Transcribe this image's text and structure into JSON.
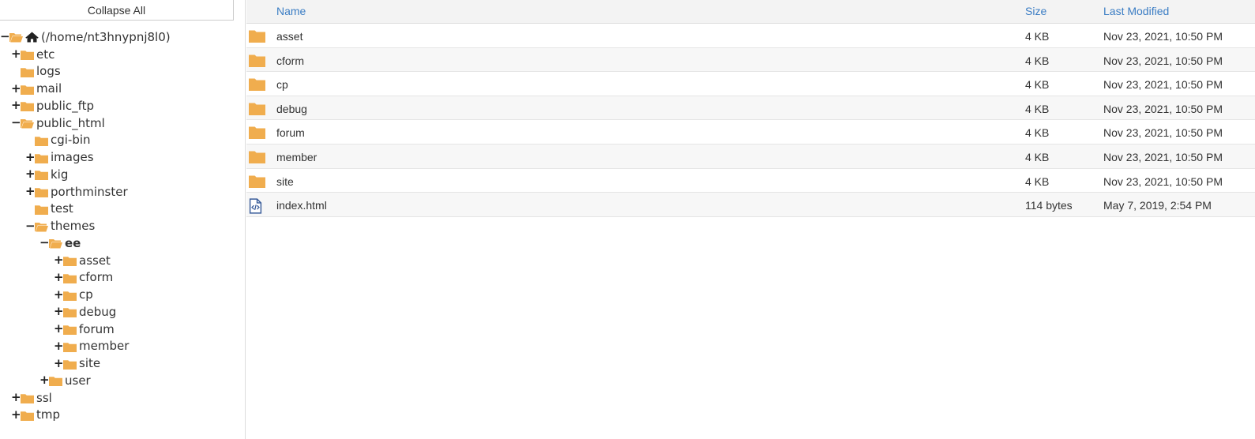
{
  "tree_panel": {
    "collapse_all_label": "Collapse All",
    "nodes": [
      {
        "label": "(/home/nt3hnypnj8l0)",
        "toggle": "−",
        "icon": "home-icon",
        "depth": 0
      },
      {
        "label": "etc",
        "toggle": "+",
        "icon": "folder-icon",
        "depth": 1
      },
      {
        "label": "logs",
        "toggle": "",
        "icon": "folder-icon",
        "depth": 1
      },
      {
        "label": "mail",
        "toggle": "+",
        "icon": "folder-icon",
        "depth": 1
      },
      {
        "label": "public_ftp",
        "toggle": "+",
        "icon": "folder-icon",
        "depth": 1
      },
      {
        "label": "public_html",
        "toggle": "−",
        "icon": "folder-open-icon",
        "depth": 1
      },
      {
        "label": "cgi-bin",
        "toggle": "",
        "icon": "folder-icon",
        "depth": 2
      },
      {
        "label": "images",
        "toggle": "+",
        "icon": "folder-icon",
        "depth": 2
      },
      {
        "label": "kig",
        "toggle": "+",
        "icon": "folder-icon",
        "depth": 2
      },
      {
        "label": "porthminster",
        "toggle": "+",
        "icon": "folder-icon",
        "depth": 2
      },
      {
        "label": "test",
        "toggle": "",
        "icon": "folder-icon",
        "depth": 2
      },
      {
        "label": "themes",
        "toggle": "−",
        "icon": "folder-open-icon",
        "depth": 2
      },
      {
        "label": "ee",
        "toggle": "−",
        "icon": "folder-open-icon",
        "depth": 3,
        "selected": true
      },
      {
        "label": "asset",
        "toggle": "+",
        "icon": "folder-icon",
        "depth": 4
      },
      {
        "label": "cform",
        "toggle": "+",
        "icon": "folder-icon",
        "depth": 4
      },
      {
        "label": "cp",
        "toggle": "+",
        "icon": "folder-icon",
        "depth": 4
      },
      {
        "label": "debug",
        "toggle": "+",
        "icon": "folder-icon",
        "depth": 4
      },
      {
        "label": "forum",
        "toggle": "+",
        "icon": "folder-icon",
        "depth": 4
      },
      {
        "label": "member",
        "toggle": "+",
        "icon": "folder-icon",
        "depth": 4
      },
      {
        "label": "site",
        "toggle": "+",
        "icon": "folder-icon",
        "depth": 4
      },
      {
        "label": "user",
        "toggle": "+",
        "icon": "folder-icon",
        "depth": 3
      },
      {
        "label": "ssl",
        "toggle": "+",
        "icon": "folder-icon",
        "depth": 1
      },
      {
        "label": "tmp",
        "toggle": "+",
        "icon": "folder-icon",
        "depth": 1
      }
    ]
  },
  "file_list": {
    "columns": {
      "name": "Name",
      "size": "Size",
      "modified": "Last Modified"
    },
    "rows": [
      {
        "name": "asset",
        "size": "4 KB",
        "modified": "Nov 23, 2021, 10:50 PM",
        "icon": "folder-icon"
      },
      {
        "name": "cform",
        "size": "4 KB",
        "modified": "Nov 23, 2021, 10:50 PM",
        "icon": "folder-icon"
      },
      {
        "name": "cp",
        "size": "4 KB",
        "modified": "Nov 23, 2021, 10:50 PM",
        "icon": "folder-icon"
      },
      {
        "name": "debug",
        "size": "4 KB",
        "modified": "Nov 23, 2021, 10:50 PM",
        "icon": "folder-icon"
      },
      {
        "name": "forum",
        "size": "4 KB",
        "modified": "Nov 23, 2021, 10:50 PM",
        "icon": "folder-icon"
      },
      {
        "name": "member",
        "size": "4 KB",
        "modified": "Nov 23, 2021, 10:50 PM",
        "icon": "folder-icon"
      },
      {
        "name": "site",
        "size": "4 KB",
        "modified": "Nov 23, 2021, 10:50 PM",
        "icon": "folder-icon"
      },
      {
        "name": "index.html",
        "size": "114 bytes",
        "modified": "May 7, 2019, 2:54 PM",
        "icon": "html-file-icon"
      }
    ]
  },
  "colors": {
    "folder": "#f0ad4e",
    "link": "#3b7dc4",
    "file_icon": "#3a5d9a"
  }
}
